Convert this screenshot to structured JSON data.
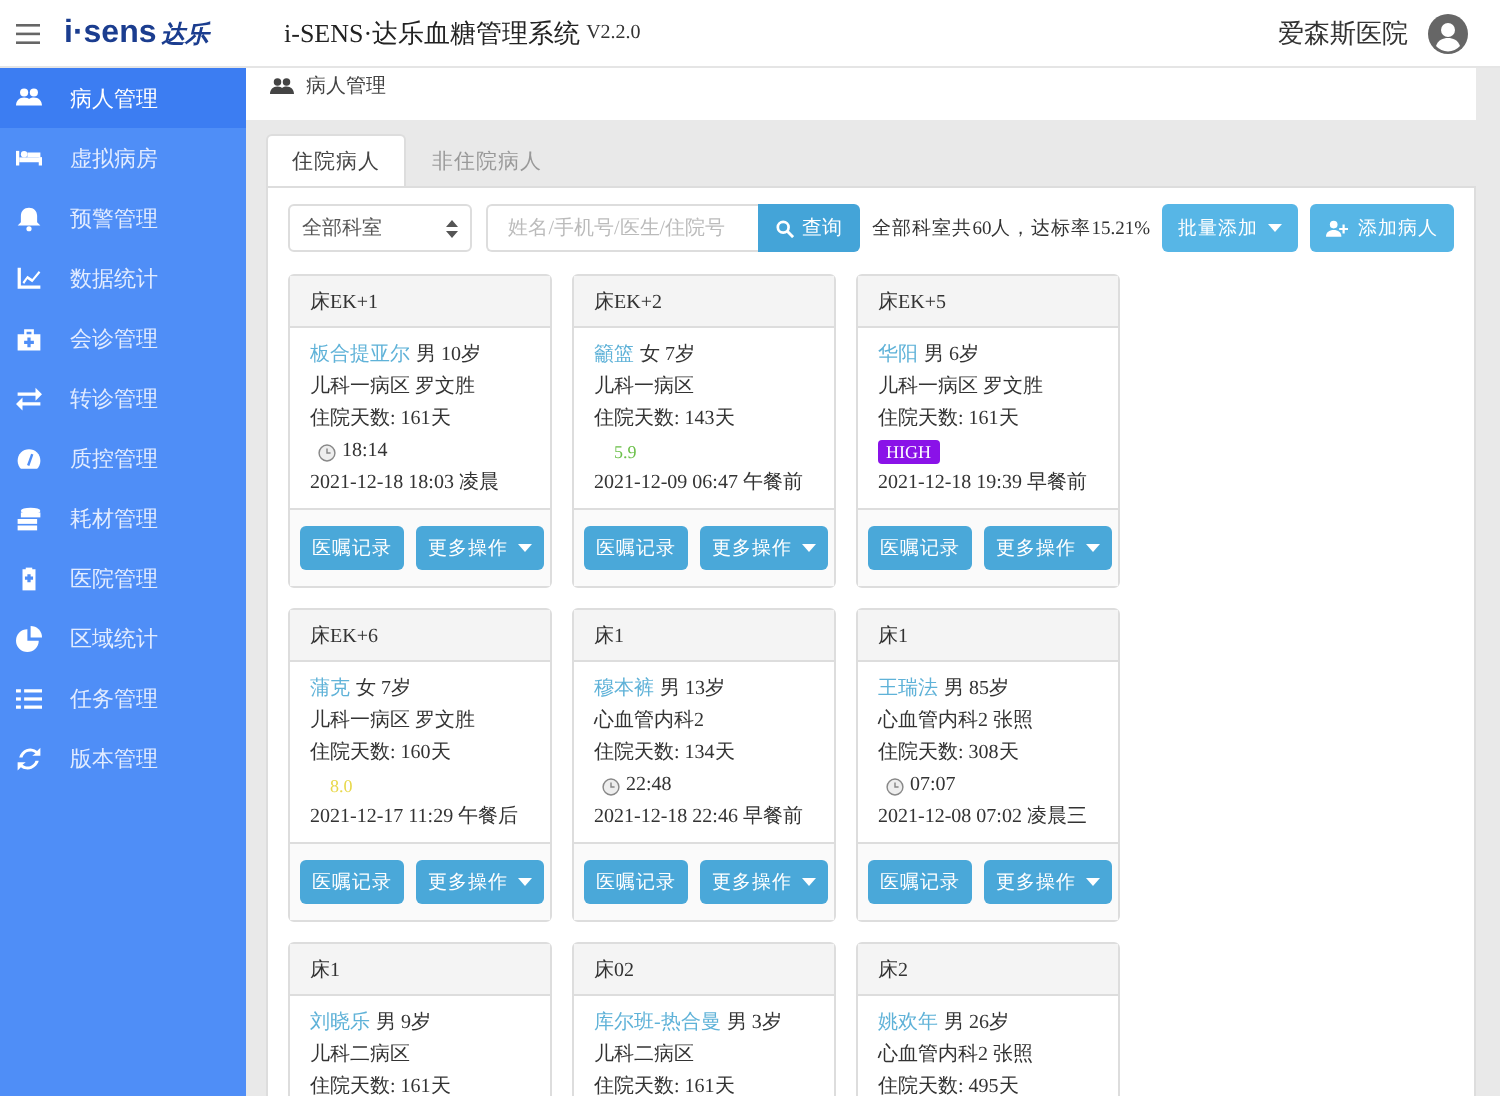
{
  "header": {
    "logo": "i·sens",
    "logo_cn": "达乐",
    "title": "i-SENS·达乐血糖管理系统",
    "version": "V2.2.0",
    "hospital": "爱森斯医院"
  },
  "sidebar": {
    "items": [
      {
        "label": "病人管理",
        "selected": true
      },
      {
        "label": "虚拟病房",
        "selected": false
      },
      {
        "label": "预警管理",
        "selected": false
      },
      {
        "label": "数据统计",
        "selected": false
      },
      {
        "label": "会诊管理",
        "selected": false
      },
      {
        "label": "转诊管理",
        "selected": false
      },
      {
        "label": "质控管理",
        "selected": false
      },
      {
        "label": "耗材管理",
        "selected": false
      },
      {
        "label": "医院管理",
        "selected": false
      },
      {
        "label": "区域统计",
        "selected": false
      },
      {
        "label": "任务管理",
        "selected": false
      },
      {
        "label": "版本管理",
        "selected": false
      }
    ]
  },
  "breadcrumb": "病人管理",
  "tabs": [
    {
      "label": "住院病人",
      "selected": true
    },
    {
      "label": "非住院病人",
      "selected": false
    }
  ],
  "toolbar": {
    "department": "全部科室",
    "search": {
      "placeholder": "姓名/手机号/医生/住院号"
    },
    "search_button": "查询",
    "summary": "全部科室共60人，达标率15.21%",
    "batch_add": "批量添加",
    "add_patient": "添加病人"
  },
  "cards": [
    {
      "bed": "床EK+1",
      "name": "板合提亚尔",
      "info": "男 10岁",
      "ward": "儿科一病区 罗文胜",
      "stay": "住院天数: 161天",
      "reading": {
        "kind": "time",
        "text": "18:14"
      },
      "record": "2021-12-18 18:03 凌晨",
      "orders": "医嘱记录",
      "more": "更多操作"
    },
    {
      "bed": "床EK+2",
      "name": "籲篮",
      "info": "女 7岁",
      "ward": "儿科一病区",
      "stay": "住院天数: 143天",
      "reading": {
        "kind": "value",
        "text": "5.9",
        "color": "#6cc04a"
      },
      "record": "2021-12-09 06:47 午餐前",
      "orders": "医嘱记录",
      "more": "更多操作"
    },
    {
      "bed": "床EK+5",
      "name": "华阳",
      "info": "男 6岁",
      "ward": "儿科一病区 罗文胜",
      "stay": "住院天数: 161天",
      "reading": {
        "kind": "badge",
        "text": "HIGH",
        "color": "#8a12e8"
      },
      "record": "2021-12-18 19:39 早餐前",
      "orders": "医嘱记录",
      "more": "更多操作"
    },
    {
      "bed": "床EK+6",
      "name": "蒲克",
      "info": "女 7岁",
      "ward": "儿科一病区 罗文胜",
      "stay": "住院天数: 160天",
      "reading": {
        "kind": "value",
        "text": "8.0",
        "color": "#e8d84a"
      },
      "record": "2021-12-17 11:29 午餐后",
      "orders": "医嘱记录",
      "more": "更多操作"
    },
    {
      "bed": "床1",
      "name": "穆本裤",
      "info": "男 13岁",
      "ward": "心血管内科2",
      "stay": "住院天数: 134天",
      "reading": {
        "kind": "time",
        "text": "22:48"
      },
      "record": "2021-12-18 22:46 早餐前",
      "orders": "医嘱记录",
      "more": "更多操作"
    },
    {
      "bed": "床1",
      "name": "王瑞法",
      "info": "男 85岁",
      "ward": "心血管内科2 张照",
      "stay": "住院天数: 308天",
      "reading": {
        "kind": "time",
        "text": "07:07"
      },
      "record": "2021-12-08 07:02 凌晨三",
      "orders": "医嘱记录",
      "more": "更多操作"
    },
    {
      "bed": "床1",
      "name": "刘晓乐",
      "info": "男 9岁",
      "ward": "儿科二病区",
      "stay": "住院天数: 161天"
    },
    {
      "bed": "床02",
      "name": "库尔班-热合曼",
      "info": "男 3岁",
      "ward": "儿科二病区",
      "stay": "住院天数: 161天"
    },
    {
      "bed": "床2",
      "name": "姚欢年",
      "info": "男 26岁",
      "ward": "心血管内科2 张照",
      "stay": "住院天数: 495天"
    }
  ]
}
